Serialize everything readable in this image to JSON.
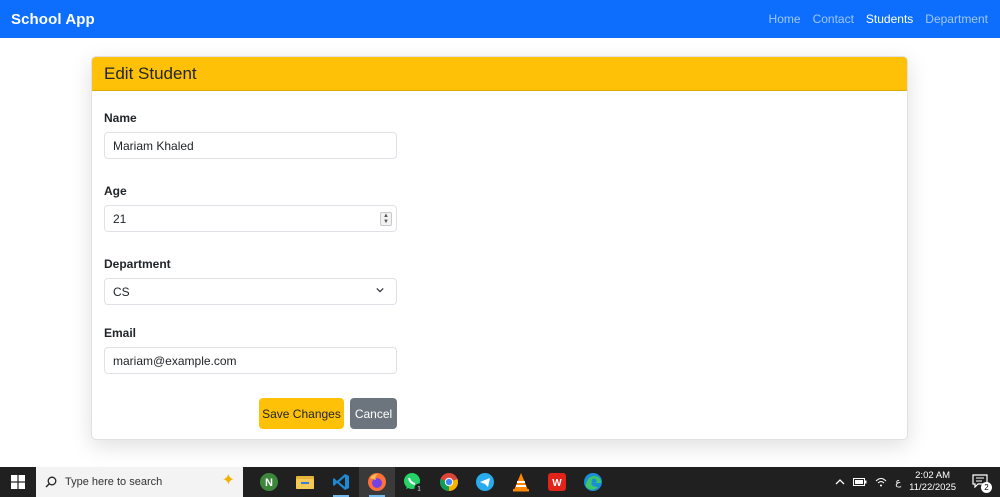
{
  "navbar": {
    "brand": "School App",
    "links": [
      {
        "label": "Home",
        "active": false
      },
      {
        "label": "Contact",
        "active": false
      },
      {
        "label": "Students",
        "active": true
      },
      {
        "label": "Department",
        "active": false
      }
    ],
    "color": "#0d6efd"
  },
  "card": {
    "title": "Edit Student",
    "header_color": "#ffc107"
  },
  "form": {
    "name": {
      "label": "Name",
      "value": "Mariam Khaled"
    },
    "age": {
      "label": "Age",
      "value": "21"
    },
    "department": {
      "label": "Department",
      "value": "CS"
    },
    "email": {
      "label": "Email",
      "value": "mariam@example.com"
    }
  },
  "buttons": {
    "save": "Save Changes",
    "cancel": "Cancel"
  },
  "taskbar": {
    "search_placeholder": "Type here to search",
    "apps": [
      "node-icon",
      "file-explorer-icon",
      "vscode-icon",
      "firefox-icon",
      "whatsapp-icon",
      "chrome-icon",
      "telegram-icon",
      "vlc-icon",
      "wps-icon",
      "edge-icon"
    ],
    "whatsapp_badge": "1",
    "lang": "ع",
    "time": "2:02 AM",
    "date": "11/22/2025",
    "notification_count": "2"
  }
}
